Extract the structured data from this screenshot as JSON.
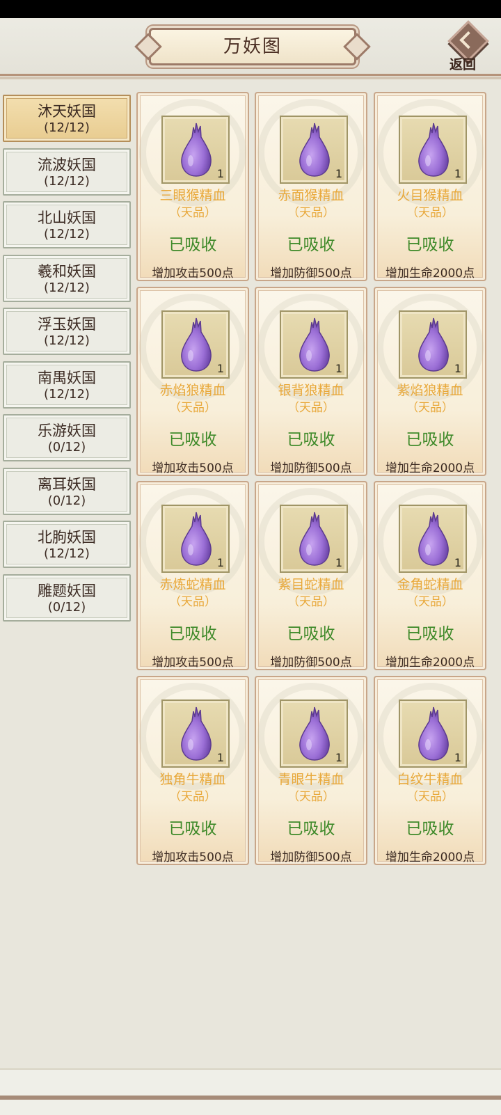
{
  "header": {
    "title": "万妖图",
    "back_label": "返回"
  },
  "sidebar": {
    "items": [
      {
        "name": "沐天妖国",
        "count": "(12/12)",
        "active": true
      },
      {
        "name": "流波妖国",
        "count": "(12/12)",
        "active": false
      },
      {
        "name": "北山妖国",
        "count": "(12/12)",
        "active": false
      },
      {
        "name": "羲和妖国",
        "count": "(12/12)",
        "active": false
      },
      {
        "name": "浮玉妖国",
        "count": "(12/12)",
        "active": false
      },
      {
        "name": "南禺妖国",
        "count": "(12/12)",
        "active": false
      },
      {
        "name": "乐游妖国",
        "count": "(0/12)",
        "active": false
      },
      {
        "name": "离耳妖国",
        "count": "(0/12)",
        "active": false
      },
      {
        "name": "北朐妖国",
        "count": "(12/12)",
        "active": false
      },
      {
        "name": "雕题妖国",
        "count": "(0/12)",
        "active": false
      }
    ]
  },
  "items": [
    {
      "name": "三眼猴精血",
      "grade": "（天品）",
      "status": "已吸收",
      "bonus": "增加攻击500点",
      "qty": "1"
    },
    {
      "name": "赤面猴精血",
      "grade": "（天品）",
      "status": "已吸收",
      "bonus": "增加防御500点",
      "qty": "1"
    },
    {
      "name": "火目猴精血",
      "grade": "（天品）",
      "status": "已吸收",
      "bonus": "增加生命2000点",
      "qty": "1"
    },
    {
      "name": "赤焰狼精血",
      "grade": "（天品）",
      "status": "已吸收",
      "bonus": "增加攻击500点",
      "qty": "1"
    },
    {
      "name": "银背狼精血",
      "grade": "（天品）",
      "status": "已吸收",
      "bonus": "增加防御500点",
      "qty": "1"
    },
    {
      "name": "紫焰狼精血",
      "grade": "（天品）",
      "status": "已吸收",
      "bonus": "增加生命2000点",
      "qty": "1"
    },
    {
      "name": "赤炼蛇精血",
      "grade": "（天品）",
      "status": "已吸收",
      "bonus": "增加攻击500点",
      "qty": "1"
    },
    {
      "name": "紫目蛇精血",
      "grade": "（天品）",
      "status": "已吸收",
      "bonus": "增加防御500点",
      "qty": "1"
    },
    {
      "name": "金角蛇精血",
      "grade": "（天品）",
      "status": "已吸收",
      "bonus": "增加生命2000点",
      "qty": "1"
    },
    {
      "name": "独角牛精血",
      "grade": "（天品）",
      "status": "已吸收",
      "bonus": "增加攻击500点",
      "qty": "1"
    },
    {
      "name": "青眼牛精血",
      "grade": "（天品）",
      "status": "已吸收",
      "bonus": "增加防御500点",
      "qty": "1"
    },
    {
      "name": "白纹牛精血",
      "grade": "（天品）",
      "status": "已吸收",
      "bonus": "增加生命2000点",
      "qty": "1"
    }
  ],
  "colors": {
    "item_name": "#e8a83a",
    "status": "#3f8a2a",
    "drop": "#9b6fd6"
  },
  "icons": {
    "item": "purple-blood-drop-icon",
    "back": "return-arrow-icon"
  }
}
